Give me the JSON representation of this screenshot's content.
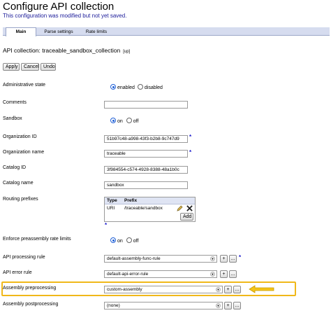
{
  "header": {
    "title": "Configure API collection",
    "notice": "This configuration was modified but not yet saved."
  },
  "tabs": [
    {
      "label": "Main",
      "active": true
    },
    {
      "label": "Parse settings",
      "active": false
    },
    {
      "label": "Rate limits",
      "active": false
    }
  ],
  "collection": {
    "heading": "API collection: traceable_sandbox_collection",
    "up_link": "[up]"
  },
  "actions": {
    "apply": "Apply",
    "cancel": "Cancel",
    "undo": "Undo"
  },
  "form": {
    "admin_state": {
      "label": "Administrative state",
      "options": [
        "enabled",
        "disabled"
      ],
      "selected": "enabled"
    },
    "comments": {
      "label": "Comments",
      "value": ""
    },
    "sandbox": {
      "label": "Sandbox",
      "options": [
        "on",
        "off"
      ],
      "selected": "on"
    },
    "organization_id": {
      "label": "Organization ID",
      "value": "51b97c48-a998-43f3-b2b8-9c747d9"
    },
    "organization_name": {
      "label": "Organization name",
      "value": "traceable"
    },
    "catalog_id": {
      "label": "Catalog ID",
      "value": "3f984554-c574-4928-8388-48a1b0c"
    },
    "catalog_name": {
      "label": "Catalog name",
      "value": "sandbox"
    },
    "routing_prefixes": {
      "label": "Routing prefixes",
      "columns": [
        "Type",
        "Prefix"
      ],
      "rows": [
        {
          "type": "URI",
          "prefix": "/traceable/sandbox"
        }
      ],
      "add_label": "Add"
    },
    "enforce_rate_limit": {
      "label": "Enforce preassembly rate limits",
      "options": [
        "on",
        "off"
      ],
      "selected": "on"
    },
    "api_processing_rule": {
      "label": "API processing rule",
      "value": "default-assembly-func-rule"
    },
    "api_error_rule": {
      "label": "API error rule",
      "value": "default-api-error-rule"
    },
    "assembly_preprocessing": {
      "label": "Assembly preprocessing",
      "value": "custom-assembly"
    },
    "assembly_postprocessing": {
      "label": "Assembly postprocessing",
      "value": "(none)"
    }
  },
  "symbols": {
    "required": "*",
    "plus": "+",
    "ellipsis": "...",
    "dropdown": "▼"
  },
  "colors": {
    "highlight": "#f0b81a",
    "notice": "#1a1a99",
    "required": "#1a1acc",
    "tabbar": "#d6dcef"
  }
}
